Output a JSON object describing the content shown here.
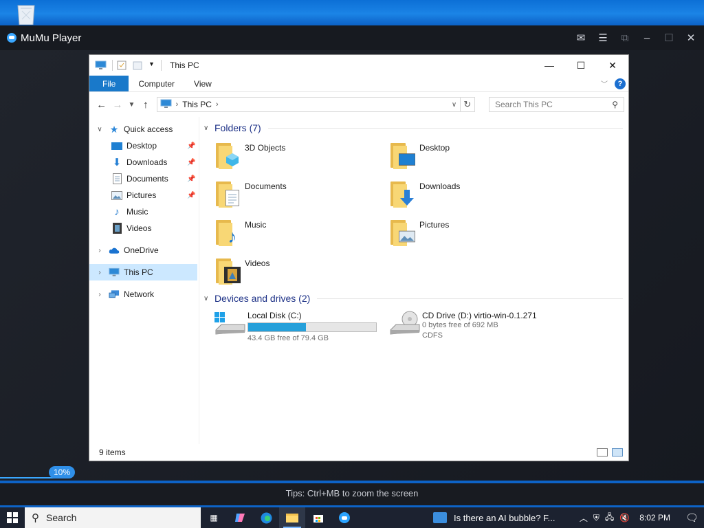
{
  "player": {
    "title": "MuMu Player",
    "progress": "10%",
    "tips": "Tips: Ctrl+MB to zoom the screen"
  },
  "window": {
    "title": "This PC",
    "tabs": {
      "file": "File",
      "computer": "Computer",
      "view": "View"
    },
    "help": "?"
  },
  "address": {
    "path": "This PC",
    "search_placeholder": "Search This PC"
  },
  "nav": {
    "quick_access": "Quick access",
    "quick_items": [
      "Desktop",
      "Downloads",
      "Documents",
      "Pictures",
      "Music",
      "Videos"
    ],
    "onedrive": "OneDrive",
    "this_pc": "This PC",
    "network": "Network"
  },
  "folders": {
    "header": "Folders (7)",
    "items": [
      "3D Objects",
      "Desktop",
      "Documents",
      "Downloads",
      "Music",
      "Pictures",
      "Videos"
    ]
  },
  "devices": {
    "header": "Devices and drives (2)",
    "drives": [
      {
        "name": "Local Disk (C:)",
        "free": "43.4 GB free of 79.4 GB",
        "used_fraction": 0.45
      },
      {
        "name": "CD Drive (D:) virtio-win-0.1.271",
        "free": "0 bytes free of 692 MB",
        "fs": "CDFS"
      }
    ]
  },
  "status": {
    "count": "9 items"
  },
  "taskbar": {
    "search": "Search",
    "news": "Is there an AI bubble? F...",
    "time": "8:02 PM"
  }
}
